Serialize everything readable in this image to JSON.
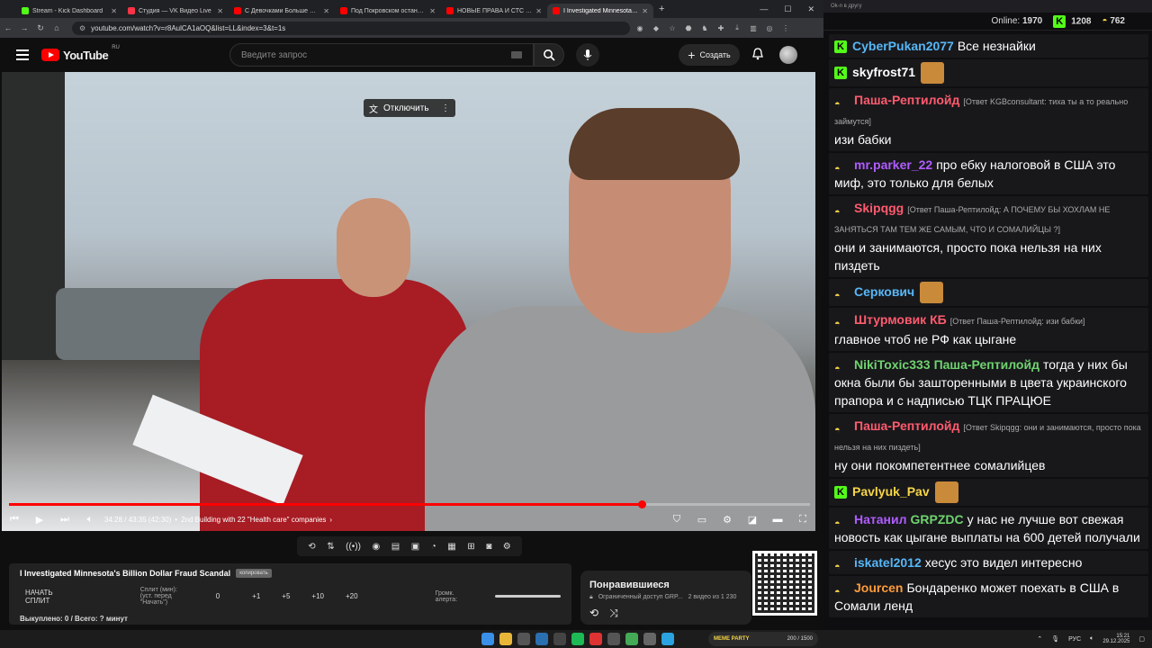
{
  "browser": {
    "tabs": [
      {
        "title": "Stream - Kick Dashboard",
        "color": "#53fc18"
      },
      {
        "title": "Студия — VK Видео Live",
        "color": "#ff3347"
      },
      {
        "title": "С Девочками Больше Не Хочу",
        "color": "#ff0000"
      },
      {
        "title": "Под Покровском остановлен",
        "color": "#ff0000"
      },
      {
        "title": "НОВЫЕ ПРАВА И СТС 2026: н",
        "color": "#ff0000"
      },
      {
        "title": "I Investigated Minnesota's Billio",
        "color": "#ff0000"
      }
    ],
    "url": "youtube.com/watch?v=r8AulCA1aOQ&list=LL&index=3&t=1s"
  },
  "youtube": {
    "logo_text": "YouTube",
    "logo_region": "RU",
    "search_placeholder": "Введите запрос",
    "create_label": "Создать",
    "translate_label": "Отключить",
    "time_current": "34:28 / 43:35 (42:30)",
    "chapter": "2nd Building with 22 \"Health care\" companies",
    "progress_fraction": 0.79
  },
  "panel": {
    "video_title": "I Investigated Minnesota's Billion Dollar Fraud Scandal",
    "badge": "копировать",
    "split_button": "НАЧАТЬ СПЛИТ",
    "split_label": "Сплит (мин):",
    "split_hint": "(уст. перед \"Начать\")",
    "split_value": "0",
    "steps": [
      "+1",
      "+5",
      "+10",
      "+20"
    ],
    "alert_label": "Громк. алерта:",
    "bought": "Выкуплено: 0 / Всего: ? минут"
  },
  "liked": {
    "title": "Понравившиеся",
    "access": "Ограниченный доступ GRP...",
    "count": "2 видео из 1 230"
  },
  "chat": {
    "header": "Ok-n в другу",
    "online_label": "Online:",
    "online": "1970",
    "kick_count": "1208",
    "vk_count": "762",
    "messages": [
      {
        "platform": "kick",
        "nick": "CyberPukan2077",
        "color": "#57b7f7",
        "text": "Все незнайки",
        "reply": ""
      },
      {
        "platform": "kick",
        "nick": "skyfrost71",
        "color": "#ffffff",
        "text": "",
        "reply": ""
      },
      {
        "platform": "vk",
        "nick": "Паша-Рептилойд",
        "color": "#ff5b6e",
        "text": "изи бабки",
        "reply": "[Ответ KGBconsultant: тиха ты а то реально займутся]"
      },
      {
        "platform": "vk",
        "nick": "mr.parker_22",
        "color": "#b05cff",
        "text": "про ебку налоговой в США это миф, это только для белых",
        "reply": ""
      },
      {
        "platform": "vk",
        "nick": "Skipqgg",
        "color": "#ff5b6e",
        "text": "они и занимаются, просто пока нельзя на них пиздеть",
        "reply": "[Ответ Паша-Рептилойд: А ПОЧЕМУ БЫ ХОХЛАМ НЕ ЗАНЯТЬСЯ ТАМ ТЕМ ЖЕ САМЫМ, ЧТО И СОМАЛИЙЦЫ ?]"
      },
      {
        "platform": "vk",
        "nick": "Серкович",
        "color": "#57b7f7",
        "text": "",
        "reply": ""
      },
      {
        "platform": "vk",
        "nick": "Штурмовик КБ",
        "color": "#ff5b6e",
        "text": "главное чтоб не РФ как цыгане",
        "reply": "[Ответ Паша-Рептилойд: изи бабки]"
      },
      {
        "platform": "vk",
        "nick": "NikiToxic333",
        "color": "#6fd36f",
        "text": "тогда у них бы окна были бы зашторенными в цвета украинского прапора и с надписью ТЦК ПРАЦЮЕ",
        "reply": "",
        "mention": "Паша-Рептилойд"
      },
      {
        "platform": "vk",
        "nick": "Паша-Рептилойд",
        "color": "#ff5b6e",
        "text": "ну они покомпетентнее сомалийцев",
        "reply": "[Ответ Skipqgg: они и занимаются, просто пока нельзя на них пиздеть]"
      },
      {
        "platform": "kick",
        "nick": "Pavlyuk_Pav",
        "color": "#f7d547",
        "text": "",
        "reply": ""
      },
      {
        "platform": "vk",
        "nick": "Натанил",
        "color": "#b05cff",
        "text": "у нас не лучше вот свежая новость как цыгане выплаты на 600 детей получали",
        "reply": "",
        "mention": "GRPZDC"
      },
      {
        "platform": "vk",
        "nick": "iskatel2012",
        "color": "#57b7f7",
        "text": "хесус это видел интересно",
        "reply": ""
      },
      {
        "platform": "vk",
        "nick": "Jourcen",
        "color": "#ff9b3b",
        "text": "Бондаренко может поехать в США в Сомали ленд",
        "reply": ""
      }
    ]
  },
  "taskbar": {
    "lang": "РУС",
    "time": "15:21",
    "date": "29.12.2025",
    "meme_label": "MEME PARTY",
    "meme_count": "200 / 1500"
  }
}
